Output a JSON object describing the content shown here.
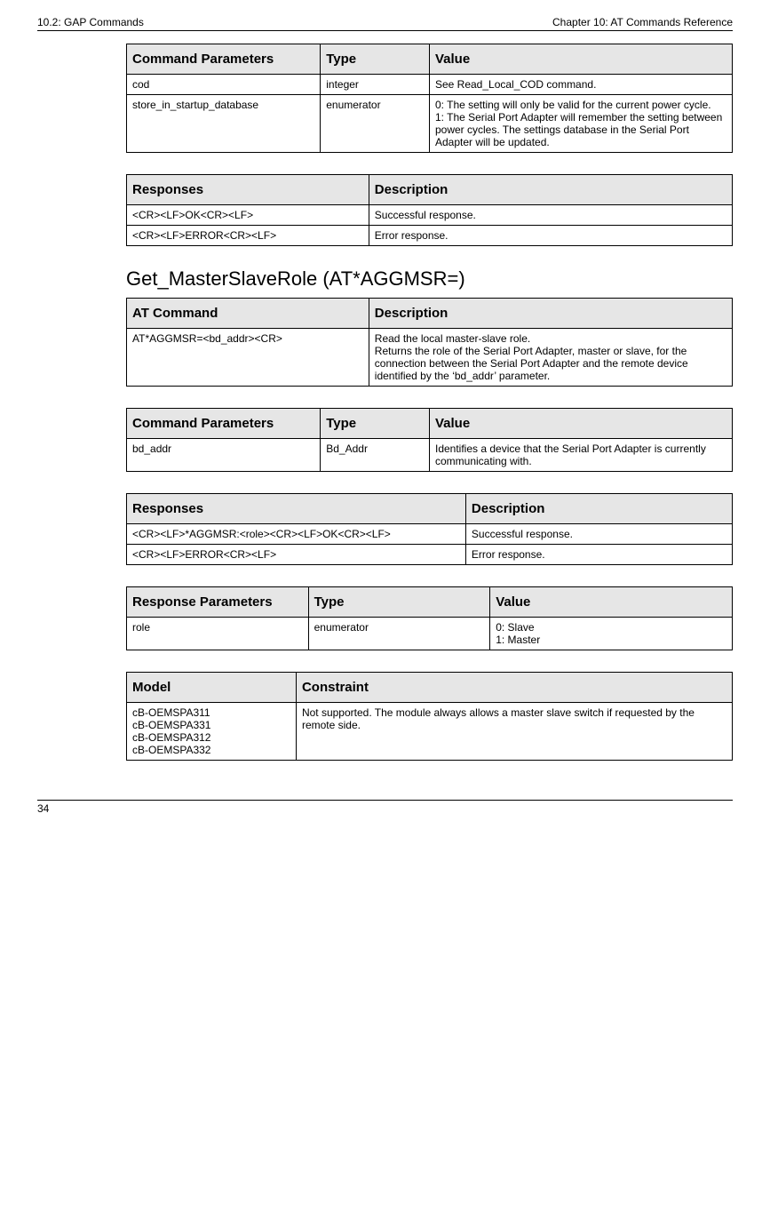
{
  "header": {
    "left": "10.2: GAP Commands",
    "right": "Chapter 10: AT Commands Reference"
  },
  "tables": {
    "cmdParams1": {
      "cols": [
        "Command Parameters",
        "Type",
        "Value"
      ],
      "rows": [
        {
          "c0": "cod",
          "c1": "integer",
          "c2": "See Read_Local_COD command."
        },
        {
          "c0": "store_in_startup_database",
          "c1": "enumerator",
          "c2": "0: The setting will only be valid for the current power cycle.\n1: The Serial Port Adapter will remember the setting between power cycles. The settings database in the Serial Port Adapter will be updated."
        }
      ]
    },
    "responses1": {
      "cols": [
        "Responses",
        "Description"
      ],
      "rows": [
        {
          "c0": "<CR><LF>OK<CR><LF>",
          "c1": "Successful response."
        },
        {
          "c0": "<CR><LF>ERROR<CR><LF>",
          "c1": "Error response."
        }
      ]
    },
    "atCommand": {
      "cols": [
        "AT Command",
        "Description"
      ],
      "rows": [
        {
          "c0": "AT*AGGMSR=<bd_addr><CR>",
          "c1": "Read the local master-slave role.\nReturns the role of the Serial Port Adapter, master or slave, for the connection between the Serial Port Adapter and the remote device identified by the ‘bd_addr’ parameter."
        }
      ]
    },
    "cmdParams2": {
      "cols": [
        "Command Parameters",
        "Type",
        "Value"
      ],
      "rows": [
        {
          "c0": "bd_addr",
          "c1": "Bd_Addr",
          "c2": "Identifies a device that the Serial Port Adapter is currently communicating with."
        }
      ]
    },
    "responses2": {
      "cols": [
        "Responses",
        "Description"
      ],
      "rows": [
        {
          "c0": "<CR><LF>*AGGMSR:<role><CR><LF>OK<CR><LF>",
          "c1": "Successful response."
        },
        {
          "c0": "<CR><LF>ERROR<CR><LF>",
          "c1": "Error response."
        }
      ]
    },
    "respParams": {
      "cols": [
        "Response Parameters",
        "Type",
        "Value"
      ],
      "rows": [
        {
          "c0": "role",
          "c1": "enumerator",
          "c2": "0: Slave\n1: Master"
        }
      ]
    },
    "model": {
      "cols": [
        "Model",
        "Constraint"
      ],
      "rows": [
        {
          "c0": "cB-OEMSPA311\ncB-OEMSPA331\ncB-OEMSPA312\ncB-OEMSPA332",
          "c1": "Not supported. The module always allows a master slave switch if requested by the remote side."
        }
      ]
    }
  },
  "sectionTitle": "Get_MasterSlaveRole (AT*AGGMSR=)",
  "pageNumber": "34"
}
